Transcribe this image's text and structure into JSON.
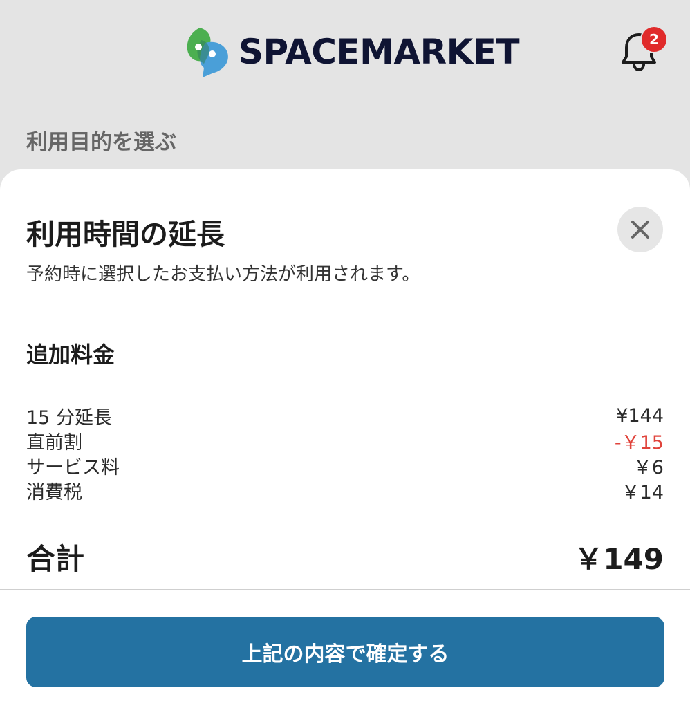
{
  "header": {
    "brand_name": "SPACEMARKET",
    "notification_count": "2",
    "brand_colors": {
      "green": "#4caf50",
      "blue": "#4a9fd8",
      "text": "#0f1433"
    }
  },
  "background": {
    "section_title": "利用目的を選ぶ"
  },
  "sheet": {
    "title": "利用時間の延長",
    "description": "予約時に選択したお支払い方法が利用されます。",
    "fee_heading": "追加料金",
    "fees": [
      {
        "label": "15 分延長",
        "amount": "¥144",
        "type": "normal"
      },
      {
        "label": "直前割",
        "amount": "-￥15",
        "type": "discount"
      },
      {
        "label": "サービス料",
        "amount": "￥6",
        "type": "normal"
      },
      {
        "label": "消費税",
        "amount": "￥14",
        "type": "normal"
      }
    ],
    "total_label": "合計",
    "total_amount": "￥149",
    "confirm_label": "上記の内容で確定する"
  },
  "colors": {
    "accent": "#2472a2",
    "discount": "#e0433b",
    "badge": "#e02b2b"
  },
  "icons": {
    "bell": "bell-icon",
    "close": "close-icon",
    "logo": "spacemarket-logo-icon"
  }
}
